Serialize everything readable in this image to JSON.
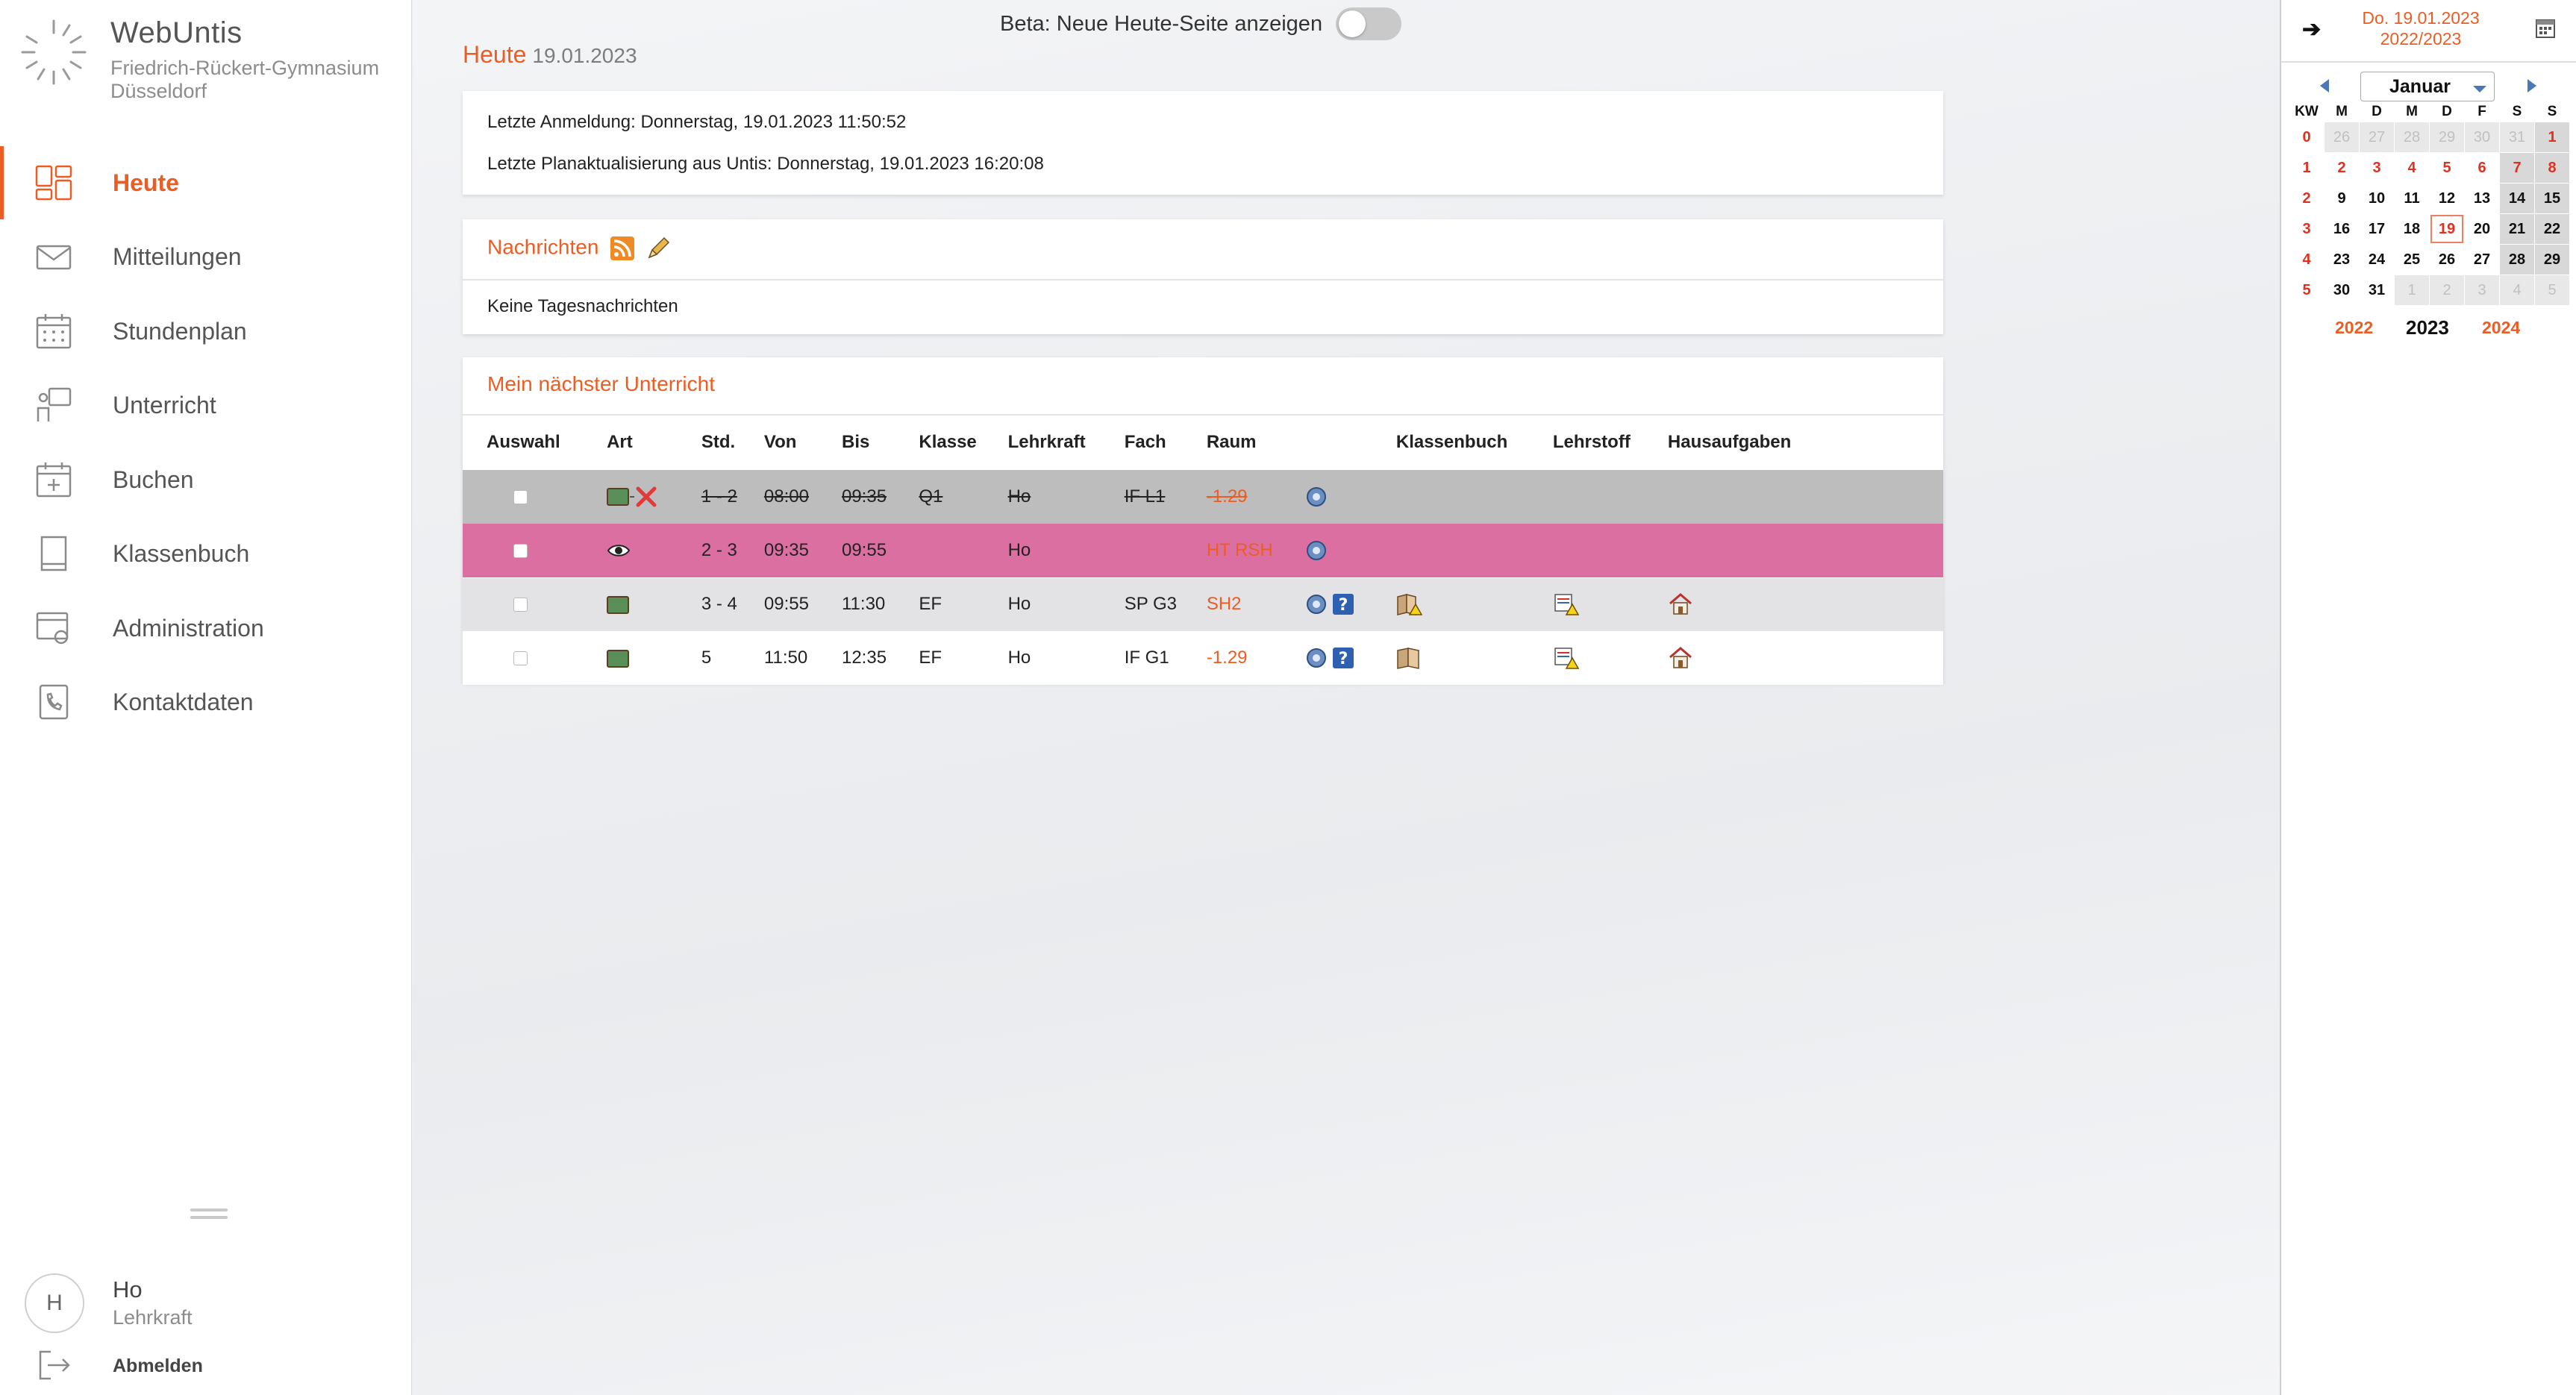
{
  "sidebar": {
    "app_name": "WebUntis",
    "school": "Friedrich-Rückert-Gymnasium Düsseldorf",
    "nav": [
      {
        "label": "Heute",
        "icon": "dashboard-icon",
        "active": true
      },
      {
        "label": "Mitteilungen",
        "icon": "envelope-icon"
      },
      {
        "label": "Stundenplan",
        "icon": "calendar-icon"
      },
      {
        "label": "Unterricht",
        "icon": "teacher-icon"
      },
      {
        "label": "Buchen",
        "icon": "calendar-plus-icon"
      },
      {
        "label": "Klassenbuch",
        "icon": "book-icon"
      },
      {
        "label": "Administration",
        "icon": "settings-icon"
      },
      {
        "label": "Kontaktdaten",
        "icon": "contact-icon"
      }
    ],
    "user": {
      "initial": "H",
      "name": "Ho",
      "role": "Lehrkraft"
    },
    "logout_label": "Abmelden"
  },
  "main": {
    "beta_label": "Beta: Neue Heute-Seite anzeigen",
    "beta_enabled": false,
    "heading": "Heute",
    "date": "19.01.2023",
    "info": {
      "last_login": "Letzte Anmeldung: Donnerstag, 19.01.2023 11:50:52",
      "last_update": "Letzte Planaktualisierung aus Untis: Donnerstag, 19.01.2023 16:20:08"
    },
    "news": {
      "title": "Nachrichten",
      "empty": "Keine Tagesnachrichten"
    },
    "lessons": {
      "title": "Mein nächster Unterricht",
      "columns": [
        "Auswahl",
        "Art",
        "Std.",
        "Von",
        "Bis",
        "Klasse",
        "Lehrkraft",
        "Fach",
        "Raum",
        "",
        "Klassenbuch",
        "Lehrstoff",
        "Hausaufgaben"
      ],
      "rows": [
        {
          "std": "1 - 2",
          "von": "08:00",
          "bis": "09:35",
          "klasse": "Q1",
          "lehrkraft": "Ho",
          "fach": "IF L1",
          "raum": "-1.29"
        },
        {
          "std": "2 - 3",
          "von": "09:35",
          "bis": "09:55",
          "klasse": "",
          "lehrkraft": "Ho",
          "fach": "",
          "raum": "HT RSH"
        },
        {
          "std": "3 - 4",
          "von": "09:55",
          "bis": "11:30",
          "klasse": "EF",
          "lehrkraft": "Ho",
          "fach": "SP G3",
          "raum": "SH2"
        },
        {
          "std": "5",
          "von": "11:50",
          "bis": "12:35",
          "klasse": "EF",
          "lehrkraft": "Ho",
          "fach": "IF G1",
          "raum": "-1.29"
        }
      ]
    }
  },
  "calendar": {
    "current_date": "Do. 19.01.2023",
    "school_year": "2022/2023",
    "month": "Januar",
    "header": [
      "KW",
      "M",
      "D",
      "M",
      "D",
      "F",
      "S",
      "S"
    ],
    "weeks": [
      {
        "kw": "0",
        "days": [
          "26",
          "27",
          "28",
          "29",
          "30",
          "31",
          "1"
        ]
      },
      {
        "kw": "1",
        "days": [
          "2",
          "3",
          "4",
          "5",
          "6",
          "7",
          "8"
        ]
      },
      {
        "kw": "2",
        "days": [
          "9",
          "10",
          "11",
          "12",
          "13",
          "14",
          "15"
        ]
      },
      {
        "kw": "3",
        "days": [
          "16",
          "17",
          "18",
          "19",
          "20",
          "21",
          "22"
        ]
      },
      {
        "kw": "4",
        "days": [
          "23",
          "24",
          "25",
          "26",
          "27",
          "28",
          "29"
        ]
      },
      {
        "kw": "5",
        "days": [
          "30",
          "31",
          "1",
          "2",
          "3",
          "4",
          "5"
        ]
      }
    ],
    "years": [
      "2022",
      "2023",
      "2024"
    ],
    "colors": {
      "accent": "#ec5d24",
      "holiday": "#e03020"
    }
  }
}
